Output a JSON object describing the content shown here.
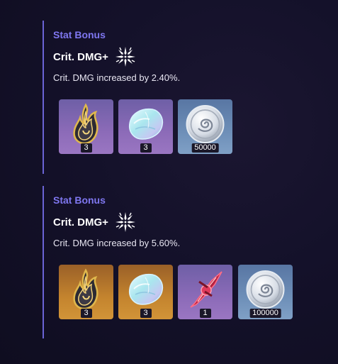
{
  "sections": [
    {
      "title": "Stat Bonus",
      "stat_name": "Crit. DMG+",
      "stat_icon": "crit-dmg-burst-icon",
      "description": "Crit. DMG increased by 2.40%.",
      "items": [
        {
          "icon": "dark-flame-material-icon",
          "quality": "purple",
          "count": "3"
        },
        {
          "icon": "iridescent-shell-material-icon",
          "quality": "purple",
          "count": "3"
        },
        {
          "icon": "silver-shell-coin-icon",
          "quality": "blue",
          "count": "50000"
        }
      ]
    },
    {
      "title": "Stat Bonus",
      "stat_name": "Crit. DMG+",
      "stat_icon": "crit-dmg-burst-icon",
      "description": "Crit. DMG increased by 5.60%.",
      "items": [
        {
          "icon": "dark-flame-material-icon",
          "quality": "orange",
          "count": "3"
        },
        {
          "icon": "iridescent-shell-material-icon",
          "quality": "orange",
          "count": "3"
        },
        {
          "icon": "crimson-crystal-material-icon",
          "quality": "purple",
          "count": "1"
        },
        {
          "icon": "silver-shell-coin-icon",
          "quality": "blue",
          "count": "100000"
        }
      ]
    }
  ],
  "colors": {
    "accent": "#7f77f0",
    "divider": "#6b64d6",
    "quality_purple": "#8c6bb8",
    "quality_blue": "#6e8fb8",
    "quality_orange": "#c4842e"
  }
}
